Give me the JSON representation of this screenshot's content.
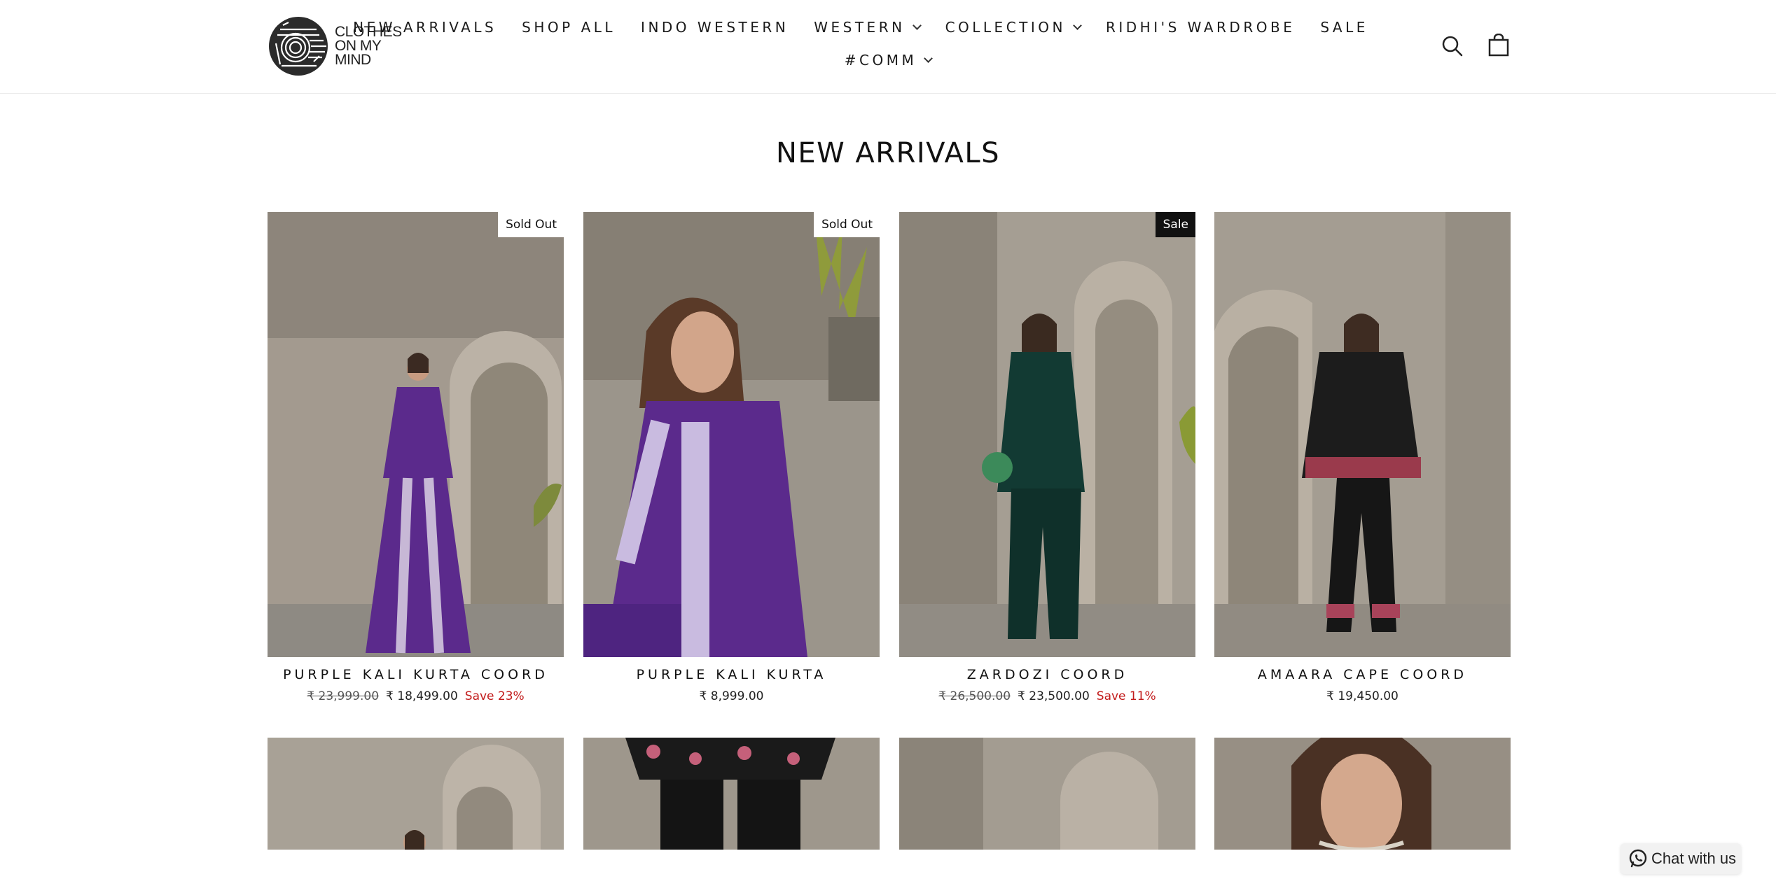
{
  "brand": {
    "logo_lines": [
      "Clothes",
      "on my",
      "mind"
    ]
  },
  "nav": {
    "row1": [
      {
        "label": "NEW ARRIVALS",
        "dropdown": false
      },
      {
        "label": "SHOP ALL",
        "dropdown": false
      },
      {
        "label": "INDO WESTERN",
        "dropdown": false
      },
      {
        "label": "WESTERN",
        "dropdown": true
      },
      {
        "label": "COLLECTION",
        "dropdown": true
      },
      {
        "label": "RIDHI'S WARDROBE",
        "dropdown": false
      },
      {
        "label": "SALE",
        "dropdown": false
      }
    ],
    "row2": [
      {
        "label": "#COMM",
        "dropdown": true
      }
    ]
  },
  "header_icons": {
    "search": "search-icon",
    "cart": "shopping-bag-icon"
  },
  "page": {
    "title": "NEW ARRIVALS"
  },
  "products": [
    {
      "title": "PURPLE KALI KURTA COORD",
      "badge": "Sold Out",
      "original_price": "₹ 23,999.00",
      "price": "₹ 18,499.00",
      "save": "Save 23%",
      "image": "woman in purple embroidered kurta and flared pants, beige arched room"
    },
    {
      "title": "PURPLE KALI KURTA",
      "badge": "Sold Out",
      "original_price": "",
      "price": "₹ 8,999.00",
      "save": "",
      "image": "close-up of woman in purple embroidered kurta seated, plant behind"
    },
    {
      "title": "ZARDOZI COORD",
      "badge": "Sale",
      "original_price": "₹ 26,500.00",
      "price": "₹ 23,500.00",
      "save": "Save 11%",
      "image": "woman in dark green velvet zardozi coord holding green potli bag"
    },
    {
      "title": "AMAARA CAPE COORD",
      "badge": "",
      "original_price": "",
      "price": "₹ 19,450.00",
      "save": "",
      "image": "woman in black cape coord with floral embroidered hem"
    }
  ],
  "colors": {
    "sale_red": "#c21a1a",
    "badge_dark": "#111111",
    "text": "#111111"
  },
  "chat": {
    "label": "Chat with us",
    "icon": "whatsapp-icon"
  }
}
